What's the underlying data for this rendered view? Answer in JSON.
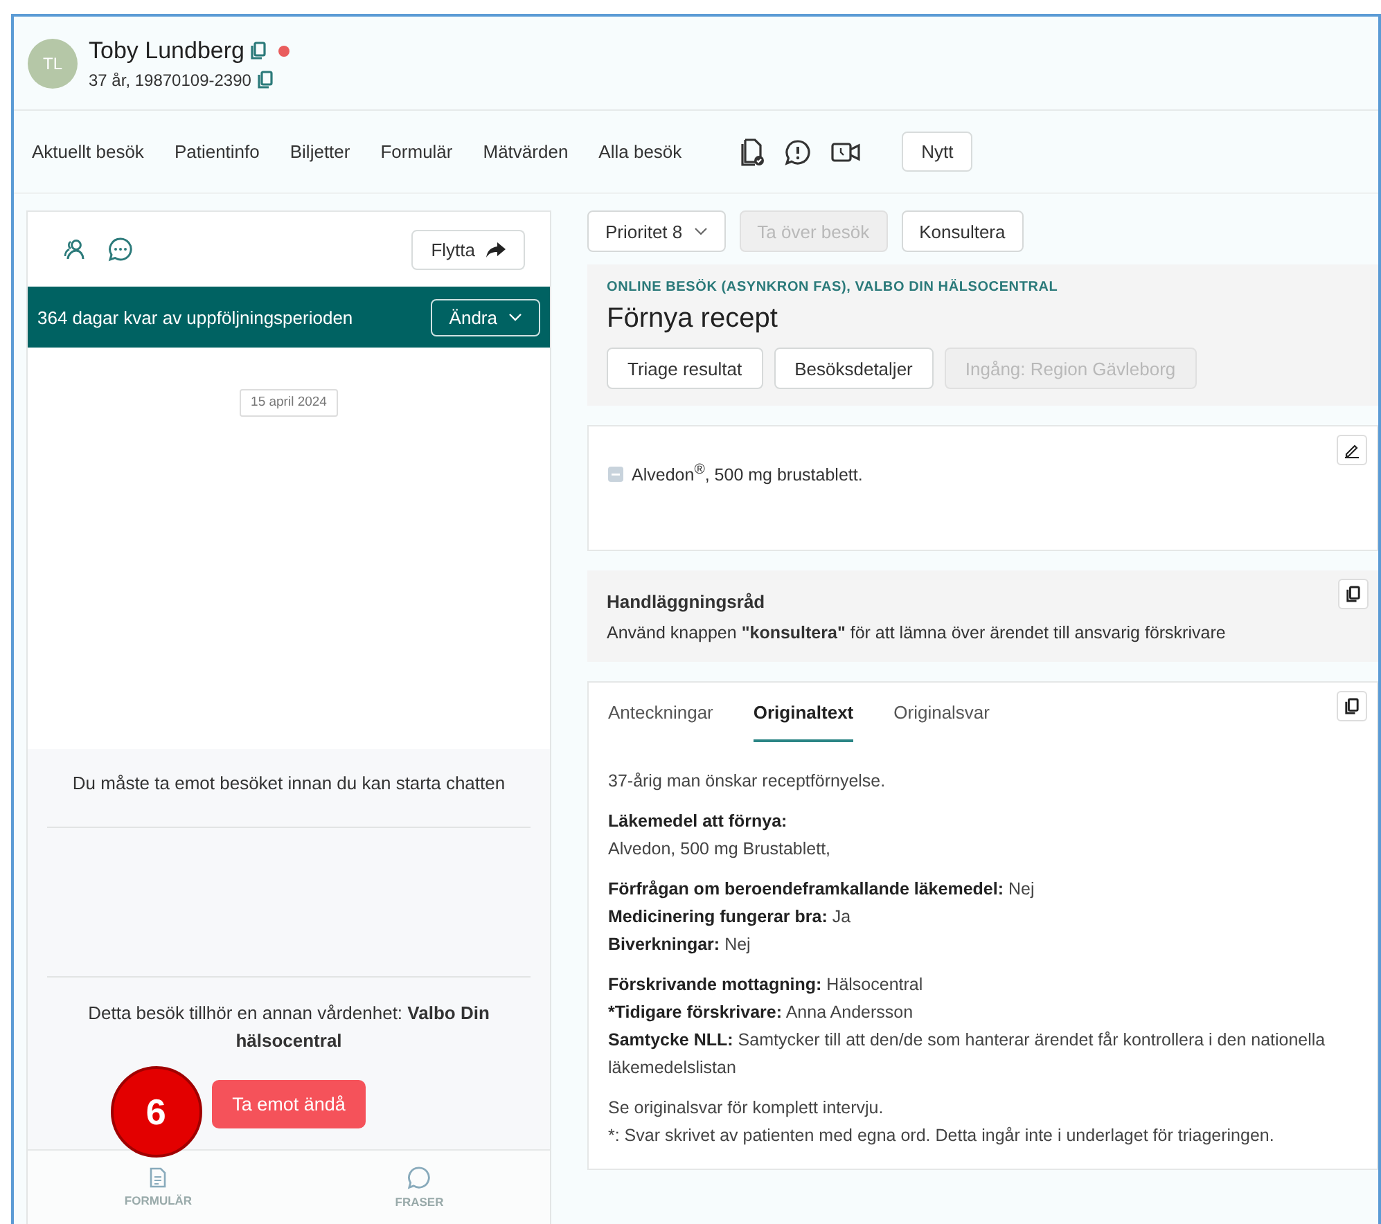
{
  "patient": {
    "initials": "TL",
    "name": "Toby Lundberg",
    "details": "37 år, 19870109-2390"
  },
  "nav": {
    "items": [
      "Aktuellt besök",
      "Patientinfo",
      "Biljetter",
      "Formulär",
      "Mätvärden",
      "Alla besök"
    ],
    "new_button": "Nytt"
  },
  "left_panel": {
    "move_button": "Flytta",
    "banner": {
      "text": "364 dagar kvar av uppföljningsperioden",
      "button": "Ändra"
    },
    "date_chip": "15 april 2024",
    "chat_notice": "Du måste ta emot besöket innan du kan starta chatten",
    "ownership_text": "Detta besök tillhör en annan vårdenhet: **Valbo Din hälsocentral**",
    "accept_button": "Ta emot ändå",
    "step_marker": "6",
    "bottom_tabs": [
      {
        "label": "FORMULÄR",
        "kind": "form"
      },
      {
        "label": "FRASER",
        "kind": "chat"
      }
    ]
  },
  "toolbar": [
    {
      "label": "Prioritet 8",
      "kind": "dropdown",
      "disabled": false
    },
    {
      "label": "Ta över besök",
      "kind": "button",
      "disabled": true
    },
    {
      "label": "Konsultera",
      "kind": "button",
      "disabled": false
    }
  ],
  "visit": {
    "category": "ONLINE BESÖK (ASYNKRON FAS), VALBO DIN HÄLSOCENTRAL",
    "title": "Förnya recept",
    "buttons": [
      {
        "label": "Triage resultat",
        "disabled": false
      },
      {
        "label": "Besöksdetaljer",
        "disabled": false
      },
      {
        "label": "Ingång: Region Gävleborg",
        "disabled": true
      }
    ]
  },
  "medication": {
    "text": "Alvedon$^{®}$, 500 mg brustablett."
  },
  "advice": {
    "title": "Handläggningsråd",
    "text": "Använd knappen **\"konsultera\"** för att lämna över ärendet till ansvarig förskrivare"
  },
  "notes": {
    "tabs": [
      {
        "label": "Anteckningar",
        "selected": false
      },
      {
        "label": "Originaltext",
        "selected": true
      },
      {
        "label": "Originalsvar",
        "selected": false
      }
    ],
    "paragraphs": [
      [
        {
          "text": "37-årig man önskar receptförnyelse."
        }
      ],
      [
        {
          "label": "Läkemedel att förnya:"
        },
        {
          "text": "Alvedon, 500 mg Brustablett,"
        }
      ],
      [
        {
          "label": "Förfrågan om beroendeframkallande läkemedel:",
          "text": "Nej"
        },
        {
          "label": "Medicinering fungerar bra:",
          "text": "Ja"
        },
        {
          "label": "Biverkningar:",
          "text": "Nej"
        }
      ],
      [
        {
          "label": "Förskrivande mottagning:",
          "text": "Hälsocentral"
        },
        {
          "label": "*Tidigare förskrivare:",
          "text": "Anna Andersson"
        },
        {
          "label": "Samtycke NLL:",
          "text": "Samtycker till att den/de som hanterar ärendet får kontrollera i den nationella läkemedelslistan"
        }
      ],
      [
        {
          "text": "Se originalsvar för komplett intervju."
        },
        {
          "text": "*: Svar skrivet av patienten med egna ord. Detta ingår inte i underlaget för triageringen."
        }
      ]
    ]
  }
}
